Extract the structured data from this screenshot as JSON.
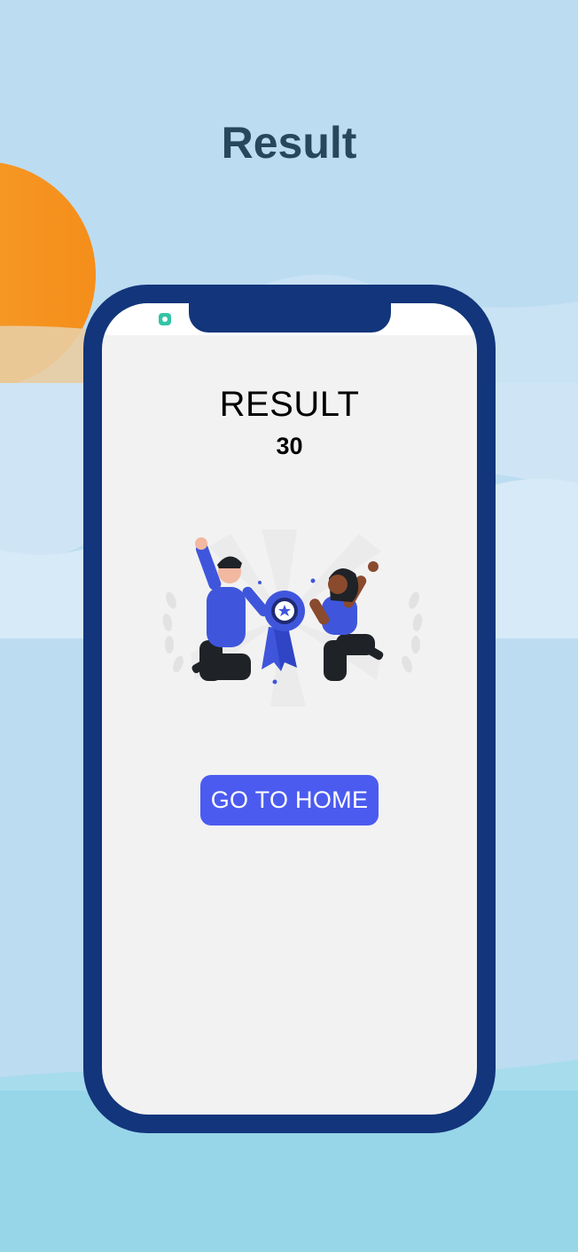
{
  "page": {
    "title": "Result"
  },
  "app": {
    "heading": "RESULT",
    "score": "30",
    "home_button_label": "GO TO HOME"
  },
  "colors": {
    "background": "#bcdcf1",
    "phone_frame": "#12357b",
    "screen": "#f2f2f2",
    "button": "#4b5bf0",
    "sun": "#f7931e",
    "title": "#26475c"
  },
  "icons": [
    "sun-decoration",
    "cloud-decoration",
    "app-badge-icon",
    "winners-illustration"
  ]
}
